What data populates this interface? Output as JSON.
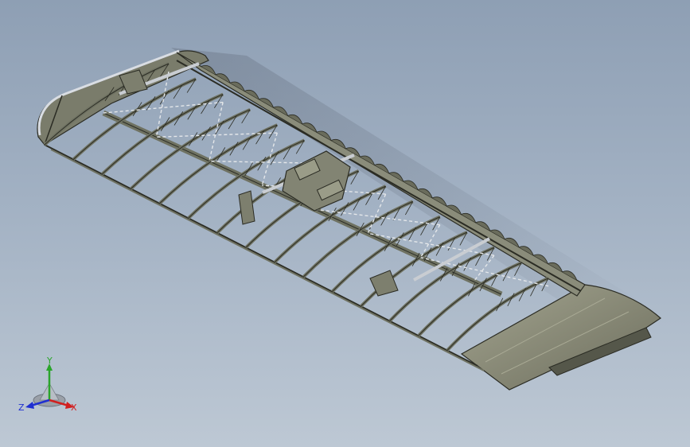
{
  "view": {
    "model_name": "",
    "background_top": "#8e9fb4",
    "background_bottom": "#bdc8d4",
    "structure_color": "#6f7262",
    "frame_line_color": "#2b2c24",
    "skin_color": "#8d8e7c"
  },
  "triad": {
    "x_label": "X",
    "y_label": "Y",
    "z_label": "Z",
    "x_color": "#d11f1f",
    "y_color": "#2aa52a",
    "z_color": "#1f2fd1"
  }
}
